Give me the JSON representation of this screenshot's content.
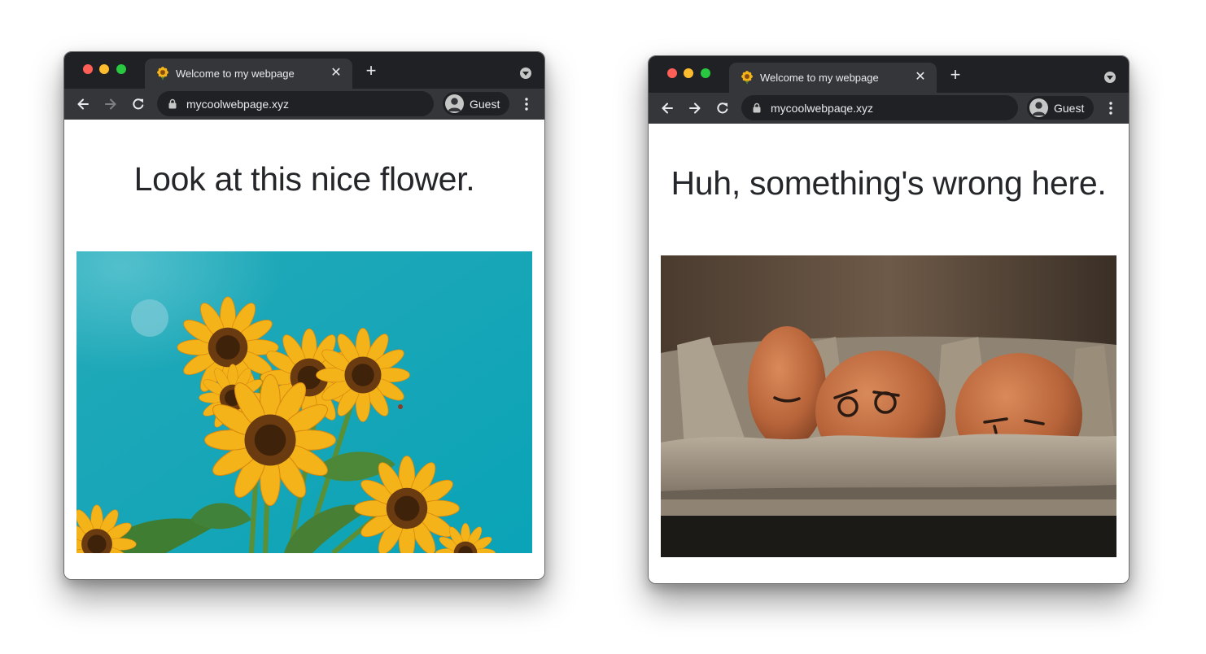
{
  "colors": {
    "chrome_dark": "#202124",
    "chrome_mid": "#35363a",
    "chrome_text": "#e8eaed",
    "icon_gray": "#c4c7c5",
    "heading_text": "#24262a",
    "sky_blue": "#16a6b8",
    "sunflower_yellow": "#f4b319"
  },
  "windows": [
    {
      "tab": {
        "favicon": "sunflower-icon",
        "title": "Welcome to my webpage"
      },
      "toolbar": {
        "url": "mycoolwebpage.xyz",
        "profile": "Guest",
        "forward_enabled": false
      },
      "page": {
        "heading": "Look at this nice flower.",
        "image": "sunflowers-against-blue-sky"
      }
    },
    {
      "tab": {
        "favicon": "sunflower-icon",
        "title": "Welcome to my webpage"
      },
      "toolbar": {
        "url": "mycoolwebpaqe.xyz",
        "profile": "Guest",
        "forward_enabled": true
      },
      "page": {
        "heading": "Huh, something's wrong here.",
        "image": "sad-eggs-in-carton"
      }
    }
  ]
}
